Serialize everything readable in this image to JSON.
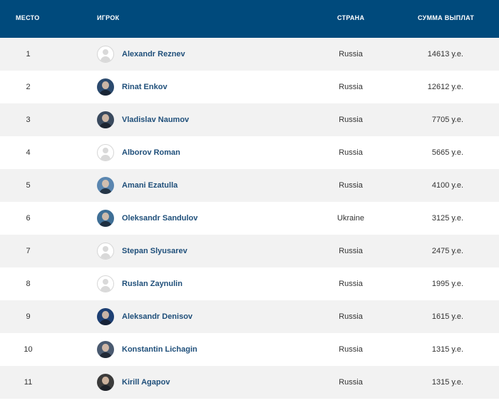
{
  "header": {
    "place": "МЕСТО",
    "player": "ИГРОК",
    "country": "СТРАНА",
    "payout": "СУММА ВЫПЛАТ"
  },
  "rows": [
    {
      "place": "1",
      "name": "Alexandr Reznev",
      "country": "Russia",
      "payout": "14613 у.е.",
      "avatar": "placeholder-avatar-icon"
    },
    {
      "place": "2",
      "name": "Rinat Enkov",
      "country": "Russia",
      "payout": "12612 у.е.",
      "avatar": "player-photo"
    },
    {
      "place": "3",
      "name": "Vladislav Naumov",
      "country": "Russia",
      "payout": "7705 у.е.",
      "avatar": "player-photo"
    },
    {
      "place": "4",
      "name": "Alborov Roman",
      "country": "Russia",
      "payout": "5665 у.е.",
      "avatar": "placeholder-avatar-icon"
    },
    {
      "place": "5",
      "name": "Amani Ezatulla",
      "country": "Russia",
      "payout": "4100 у.е.",
      "avatar": "player-photo"
    },
    {
      "place": "6",
      "name": "Oleksandr Sandulov",
      "country": "Ukraine",
      "payout": "3125 у.е.",
      "avatar": "player-photo"
    },
    {
      "place": "7",
      "name": "Stepan Slyusarev",
      "country": "Russia",
      "payout": "2475 у.е.",
      "avatar": "placeholder-avatar-icon"
    },
    {
      "place": "8",
      "name": "Ruslan Zaynulin",
      "country": "Russia",
      "payout": "1995 у.е.",
      "avatar": "placeholder-avatar-icon"
    },
    {
      "place": "9",
      "name": "Aleksandr Denisov",
      "country": "Russia",
      "payout": "1615 у.е.",
      "avatar": "player-photo"
    },
    {
      "place": "10",
      "name": "Konstantin Lichagin",
      "country": "Russia",
      "payout": "1315 у.е.",
      "avatar": "player-photo"
    },
    {
      "place": "11",
      "name": "Kirill Agapov",
      "country": "Russia",
      "payout": "1315 у.е.",
      "avatar": "player-photo"
    }
  ],
  "colors": {
    "header_bg": "#004a7c",
    "header_text": "#ffffff",
    "name_text": "#1f4f7a",
    "row_alt_bg": "#f2f2f2"
  },
  "avatar_colors": [
    "#2b4a6e",
    "#3a4a5e",
    "#5a86b0",
    "#3f6f96",
    "#1d3f73",
    "#4a5a70",
    "#3b3b3b"
  ]
}
